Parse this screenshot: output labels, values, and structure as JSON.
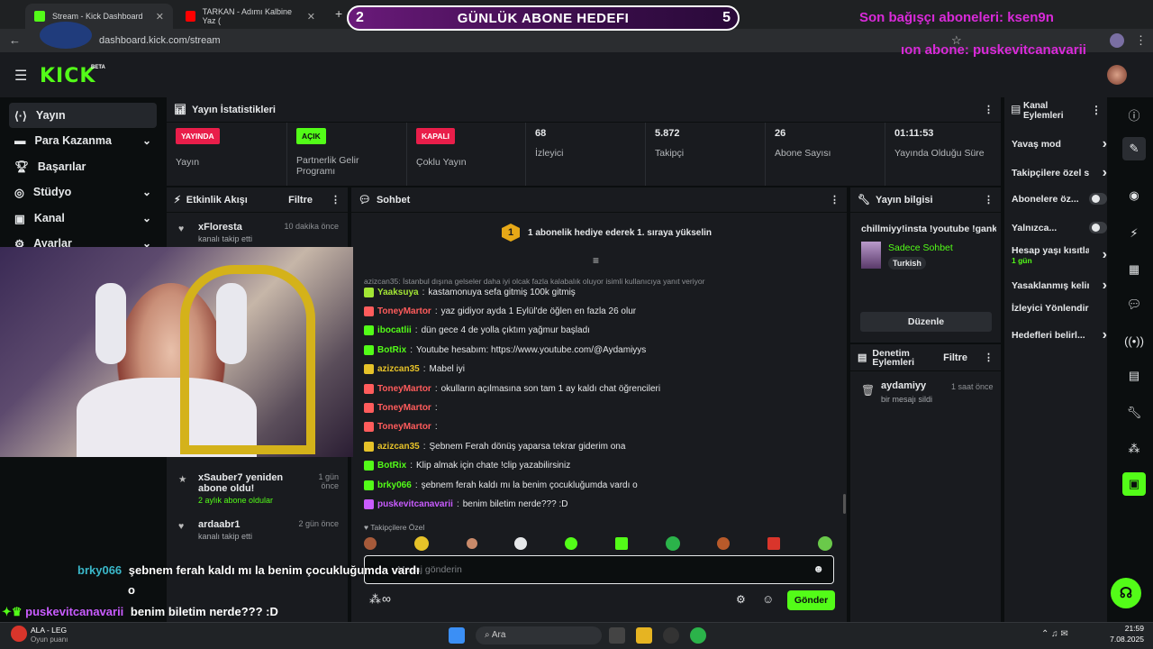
{
  "browser": {
    "tabs": [
      {
        "title": "Stream - Kick Dashboard",
        "favicon_color": "#53fc18"
      },
      {
        "title": "TARKAN - Adımı Kalbine Yaz (",
        "favicon_color": "#ff0000"
      }
    ],
    "url": "dashboard.kick.com/stream",
    "new_tab": "+"
  },
  "overlay": {
    "goal": {
      "left_num": "2",
      "label": "GÜNLÜK ABONE HEDEFI",
      "right_num": "5"
    },
    "last_donor": "Son bağışçı aboneleri: ksen9n",
    "last_sub": "ıon abone: puskevitcanavarii",
    "caption_1_user": "brky066",
    "caption_1_text": "şebnem ferah kaldı mı la benim çocukluğumda vardı",
    "caption_1_extra": "o",
    "caption_2_user": "puskevitcanavarii",
    "caption_2_text": "benim biletim nerde??? :D"
  },
  "site": {
    "logo": "KICK",
    "logo_badge": "BETA",
    "sidebar": [
      {
        "label": "Yayın",
        "icon": "broadcast-icon",
        "active": true,
        "chevron": false
      },
      {
        "label": "Para Kazanma",
        "icon": "money-icon",
        "active": false,
        "chevron": true
      },
      {
        "label": "Başarılar",
        "icon": "trophy-icon",
        "active": false,
        "chevron": false
      },
      {
        "label": "Stüdyo",
        "icon": "studio-icon",
        "active": false,
        "chevron": true
      },
      {
        "label": "Kanal",
        "icon": "channel-icon",
        "active": false,
        "chevron": true
      },
      {
        "label": "Ayarlar",
        "icon": "settings-icon",
        "active": false,
        "chevron": true
      }
    ],
    "stats_header": "Yayın İstatistikleri",
    "stats": [
      {
        "badge": "YAYINDA",
        "badge_color": "#e91e4a",
        "label": "Yayın"
      },
      {
        "badge": "AÇIK",
        "badge_color": "#53fc18",
        "label": "Partnerlik Gelir Programı"
      },
      {
        "badge": "KAPALI",
        "badge_color": "#e91e4a",
        "label": "Çoklu Yayın"
      },
      {
        "value": "68",
        "label": "İzleyici"
      },
      {
        "value": "5.872",
        "label": "Takipçi"
      },
      {
        "value": "26",
        "label": "Abone Sayısı"
      },
      {
        "value": "01:11:53",
        "label": "Yayında Olduğu Süre"
      }
    ],
    "activity": {
      "title": "Etkinlik Akışı",
      "filter": "Filtre",
      "items": [
        {
          "name": "xFloresta",
          "sub": "kanalı takip etti",
          "time": "10 dakika önce"
        },
        {
          "name": "",
          "sub": "kanalı takip etti",
          "time": ""
        },
        {
          "name": "xSauber7 yeniden abone oldu!",
          "sub": "2 aylık abone oldular",
          "time": "1 gün önce"
        },
        {
          "name": "ardaabr1",
          "sub": "kanalı takip etti",
          "time": "2 gün önce"
        }
      ]
    },
    "chat": {
      "title": "Sohbet",
      "banner": "1 abonelik hediye ederek 1. sıraya yükselin",
      "banner_num": "1",
      "reply_hint": "azizcan35: İstanbul dışına gelseler daha iyi olcak fazla kalabalık oluyor isimli kullanıcıya yanıt veriyor",
      "messages": [
        {
          "user": "Yaaksuya",
          "color": "#a3e635",
          "text": "kastamonuya sefa gitmiş 100k gitmiş"
        },
        {
          "user": "ToneyMartor",
          "color": "#ff5c5c",
          "text": "yaz gidiyor ayda 1 Eylül'de öğlen en fazla 26 olur"
        },
        {
          "user": "ibocatlii",
          "color": "#53fc18",
          "text": "dün gece 4 de yolla çıktım yağmur başladı"
        },
        {
          "user": "BotRix",
          "color": "#53fc18",
          "text": "Youtube hesabım: https://www.youtube.com/@Aydamiyys"
        },
        {
          "user": "azizcan35",
          "color": "#e6c229",
          "text": "Mabel iyi"
        },
        {
          "user": "ToneyMartor",
          "color": "#ff5c5c",
          "text": "okulların açılmasına son tam 1 ay kaldı chat öğrencileri"
        },
        {
          "user": "ToneyMartor",
          "color": "#ff5c5c",
          "text": ""
        },
        {
          "user": "ToneyMartor",
          "color": "#ff5c5c",
          "text": ""
        },
        {
          "user": "azizcan35",
          "color": "#e6c229",
          "text": "Şebnem Ferah dönüş yaparsa tekrar giderim ona"
        },
        {
          "user": "BotRix",
          "color": "#53fc18",
          "text": "Klip almak için chate !clip yazabilirsiniz"
        },
        {
          "user": "brky066",
          "color": "#53fc18",
          "text": "şebnem ferah kaldı mı la benim çocukluğumda vardı o"
        },
        {
          "user": "puskevitcanavarii",
          "color": "#c95cff",
          "text": "benim biletim nerde??? :D"
        }
      ],
      "followers_only": "Takipçilere Özel",
      "placeholder": "Mesaj gönderin",
      "send": "Gönder",
      "infinity": "∞"
    },
    "stream_info": {
      "title": "Yayın bilgisi",
      "stream_title": "chillmiyy!insta !youtube !gank",
      "category": "Sadece Sohbet",
      "tag": "Turkish",
      "edit": "Düzenle"
    },
    "moderation": {
      "title": "Denetim Eylemleri",
      "filter": "Filtre",
      "items": [
        {
          "name": "aydamiyy",
          "sub": "bir mesajı sildi",
          "time": "1 saat önce"
        }
      ]
    },
    "channel_actions": {
      "title": "Kanal Eylemleri",
      "items": [
        {
          "label": "Yavaş mod",
          "kind": "chevron"
        },
        {
          "label": "Takipçilere özel s",
          "kind": "chevron"
        },
        {
          "label": "Abonelere öz...",
          "kind": "toggle"
        },
        {
          "label": "Yalnızca...",
          "kind": "toggle"
        },
        {
          "label": "Hesap yaşı kısıtla",
          "sub": "1 gün",
          "kind": "chevron"
        },
        {
          "label": "Yasaklanmış kelim",
          "kind": "chevron"
        },
        {
          "label": "İzleyici Yönlendir",
          "kind": "none"
        },
        {
          "label": "Hedefleri belirl...",
          "kind": "chevron"
        }
      ]
    }
  },
  "taskbar": {
    "weather_title": "ALA - LEG",
    "weather_sub": "Oyun puanı",
    "search": "Ara",
    "time": "21:59",
    "date": "7.08.2025"
  },
  "colors": {
    "accent": "#53fc18",
    "panel": "#191b1f",
    "bg": "#0b0e0f",
    "overlay_pink": "#d92ad9"
  }
}
